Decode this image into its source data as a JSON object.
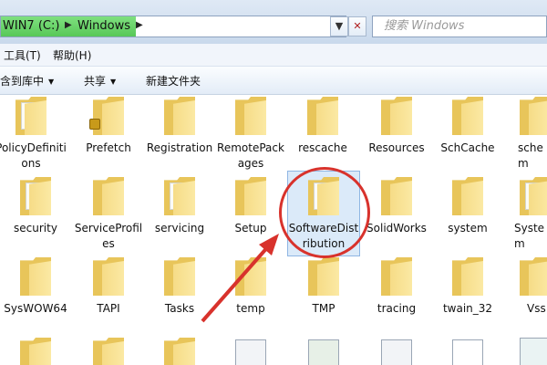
{
  "address": {
    "crumbs": [
      "WIN7 (C:)",
      "Windows"
    ],
    "dropdown_glyph": "▼",
    "refresh_glyph": "✕",
    "search_placeholder": "搜索 Windows"
  },
  "menu": {
    "items": [
      "工具(T)",
      "帮助(H)"
    ]
  },
  "toolbar": {
    "items": [
      {
        "label": "含到库中",
        "has_arrow": true
      },
      {
        "label": "共享",
        "has_arrow": true
      },
      {
        "label": "新建文件夹",
        "has_arrow": false
      }
    ]
  },
  "files": {
    "row1": [
      "PolicyDefinitions",
      "Prefetch",
      "Registration",
      "RemotePackages",
      "rescache",
      "Resources",
      "SchCache",
      "schem"
    ],
    "row2": [
      "security",
      "ServiceProfiles",
      "servicing",
      "Setup",
      "SoftwareDistribution",
      "SolidWorks",
      "system",
      "System"
    ],
    "row3": [
      "SysWOW64",
      "TAPI",
      "Tasks",
      "temp",
      "TMP",
      "tracing",
      "twain_32",
      "Vss"
    ],
    "selected": "SoftwareDistribution"
  },
  "colors": {
    "highlight_circle": "#d8322c",
    "address_progress": "#58c858",
    "folder": "#e8c55a"
  }
}
